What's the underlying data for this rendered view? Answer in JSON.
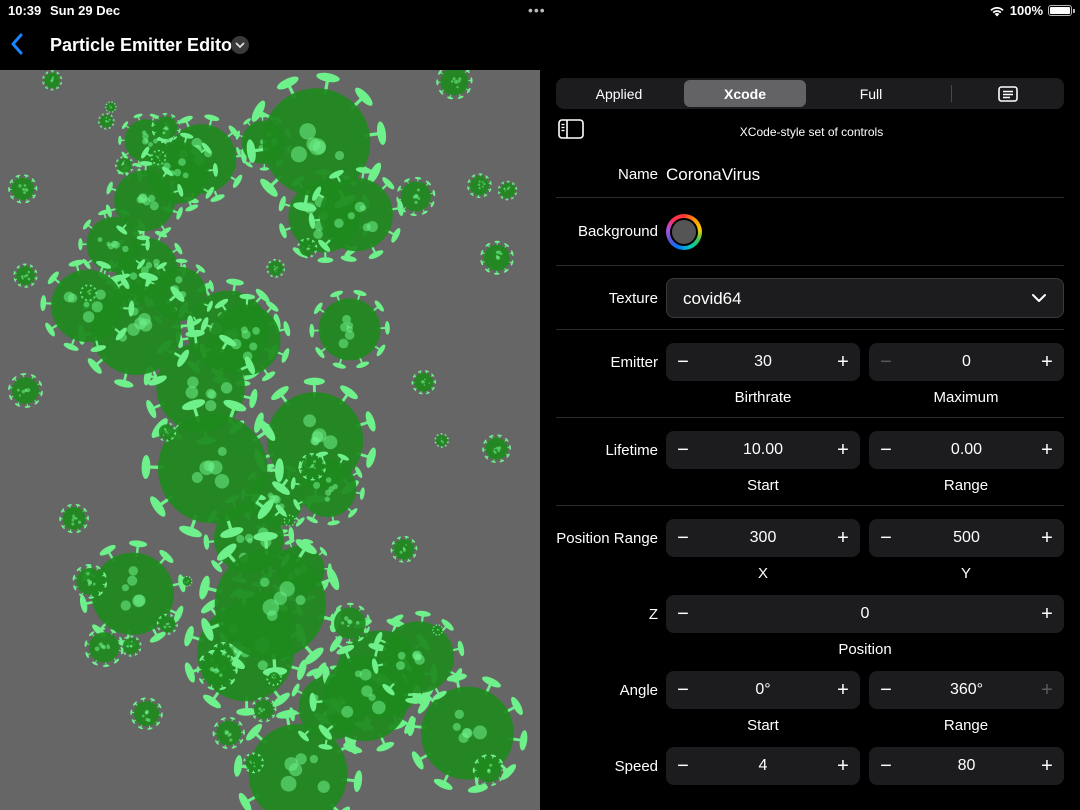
{
  "status": {
    "time": "10:39",
    "date": "Sun 29 Dec",
    "dots": "•••",
    "battery": "100%",
    "battery_level": 1.0
  },
  "nav": {
    "title": "Particle Emitter Editor"
  },
  "inspector": {
    "tabs": [
      {
        "label": "Applied",
        "selected": false
      },
      {
        "label": "Xcode",
        "selected": true
      },
      {
        "label": "Full",
        "selected": false
      }
    ],
    "caption": "XCode-style set of controls",
    "name": {
      "label": "Name",
      "value": "CoronaVirus"
    },
    "background": {
      "label": "Background"
    },
    "texture": {
      "label": "Texture",
      "value": "covid64"
    },
    "emitter": {
      "label": "Emitter",
      "birthrate": {
        "value": "30",
        "caption": "Birthrate"
      },
      "maximum": {
        "value": "0",
        "caption": "Maximum"
      }
    },
    "lifetime": {
      "label": "Lifetime",
      "start": {
        "value": "10.00",
        "caption": "Start"
      },
      "range": {
        "value": "0.00",
        "caption": "Range"
      }
    },
    "position_range": {
      "label": "Position Range",
      "x": {
        "value": "300",
        "caption": "X"
      },
      "y": {
        "value": "500",
        "caption": "Y"
      }
    },
    "z": {
      "label": "Z",
      "position": {
        "value": "0",
        "caption": "Position"
      }
    },
    "angle": {
      "label": "Angle",
      "start": {
        "value": "0°",
        "caption": "Start"
      },
      "range": {
        "value": "360°",
        "caption": "Range"
      }
    },
    "speed": {
      "label": "Speed",
      "start": {
        "value": "4"
      },
      "range": {
        "value": "80"
      }
    },
    "stepper_minus": "−",
    "stepper_plus": "+"
  },
  "colors": {
    "accent": "#1a84ff",
    "preview_bg": "#666666",
    "virus_body": "#1e8a1e",
    "virus_spike": "#6ef08a"
  }
}
